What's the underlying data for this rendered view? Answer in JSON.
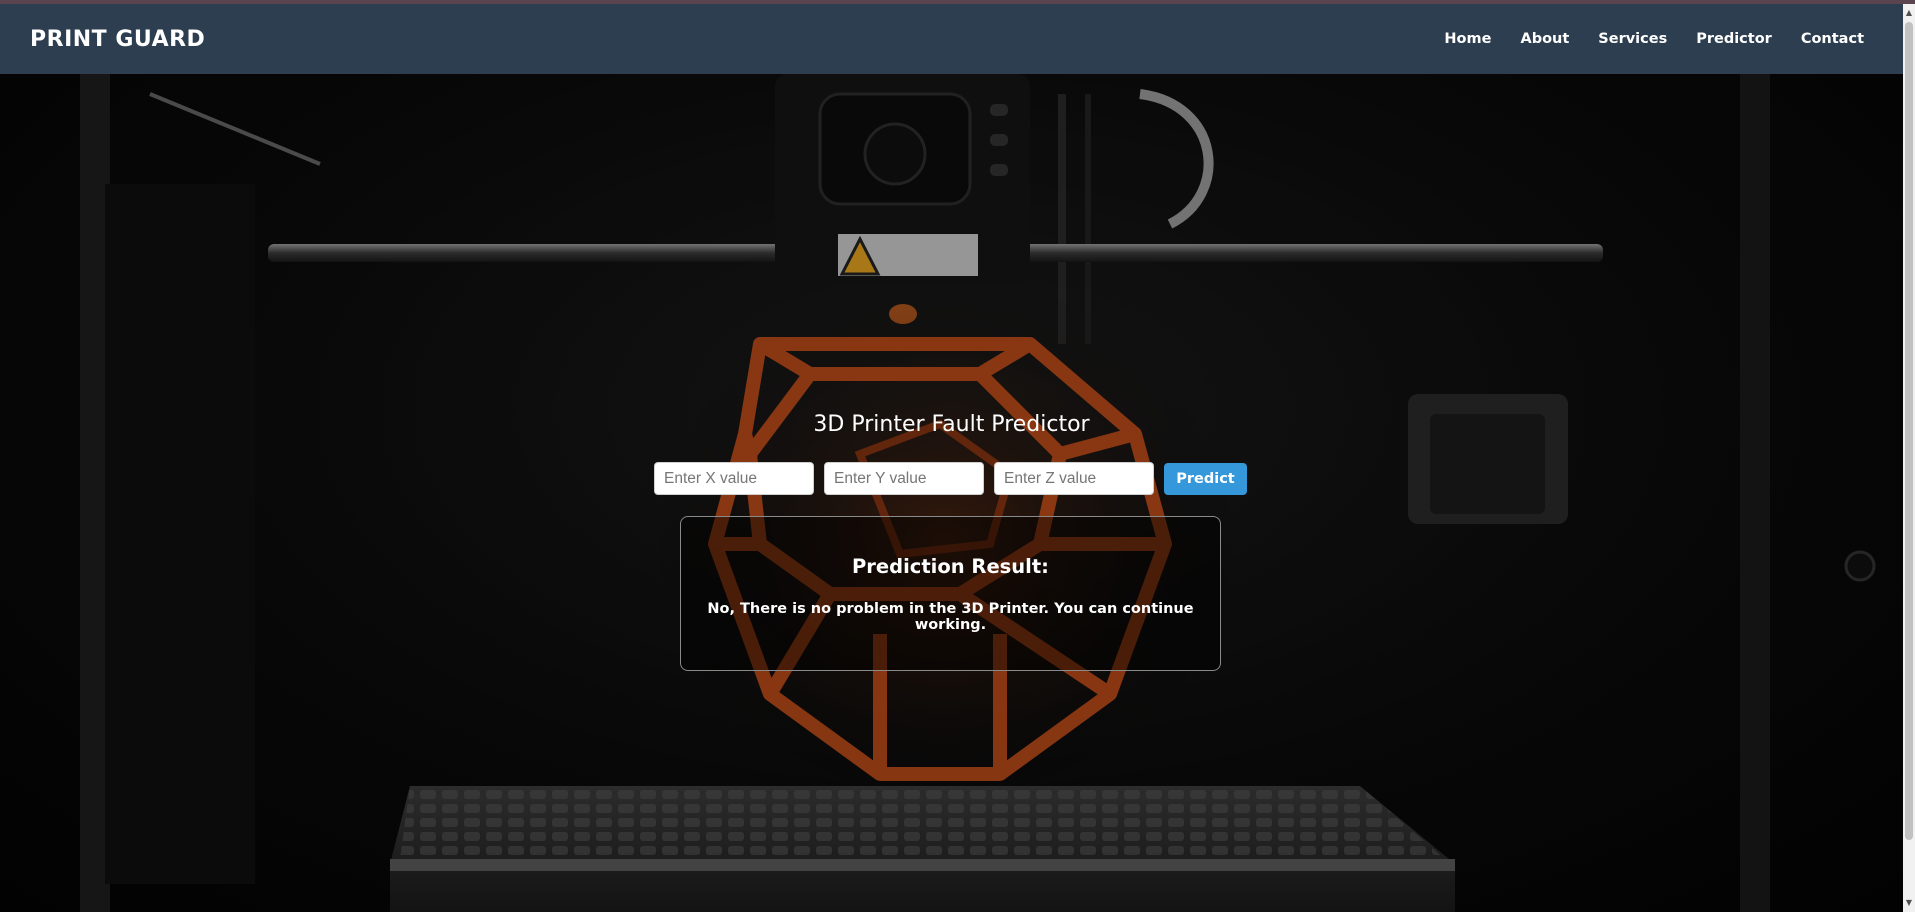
{
  "navbar": {
    "brand": "PRINT GUARD",
    "links": [
      "Home",
      "About",
      "Services",
      "Predictor",
      "Contact"
    ]
  },
  "main": {
    "title": "3D Printer Fault Predictor",
    "inputs": {
      "x_placeholder": "Enter X value",
      "y_placeholder": "Enter Y value",
      "z_placeholder": "Enter Z value"
    },
    "predict_label": "Predict",
    "result": {
      "heading": "Prediction Result:",
      "message": "No, There is no problem in the 3D Printer. You can continue working."
    }
  },
  "colors": {
    "navbar_bg": "#2d3e50",
    "accent": "#3498db",
    "print_orange": "#c8501a"
  },
  "icons": {
    "scroll_up": "triangle-up-icon",
    "scroll_down": "triangle-down-icon"
  }
}
